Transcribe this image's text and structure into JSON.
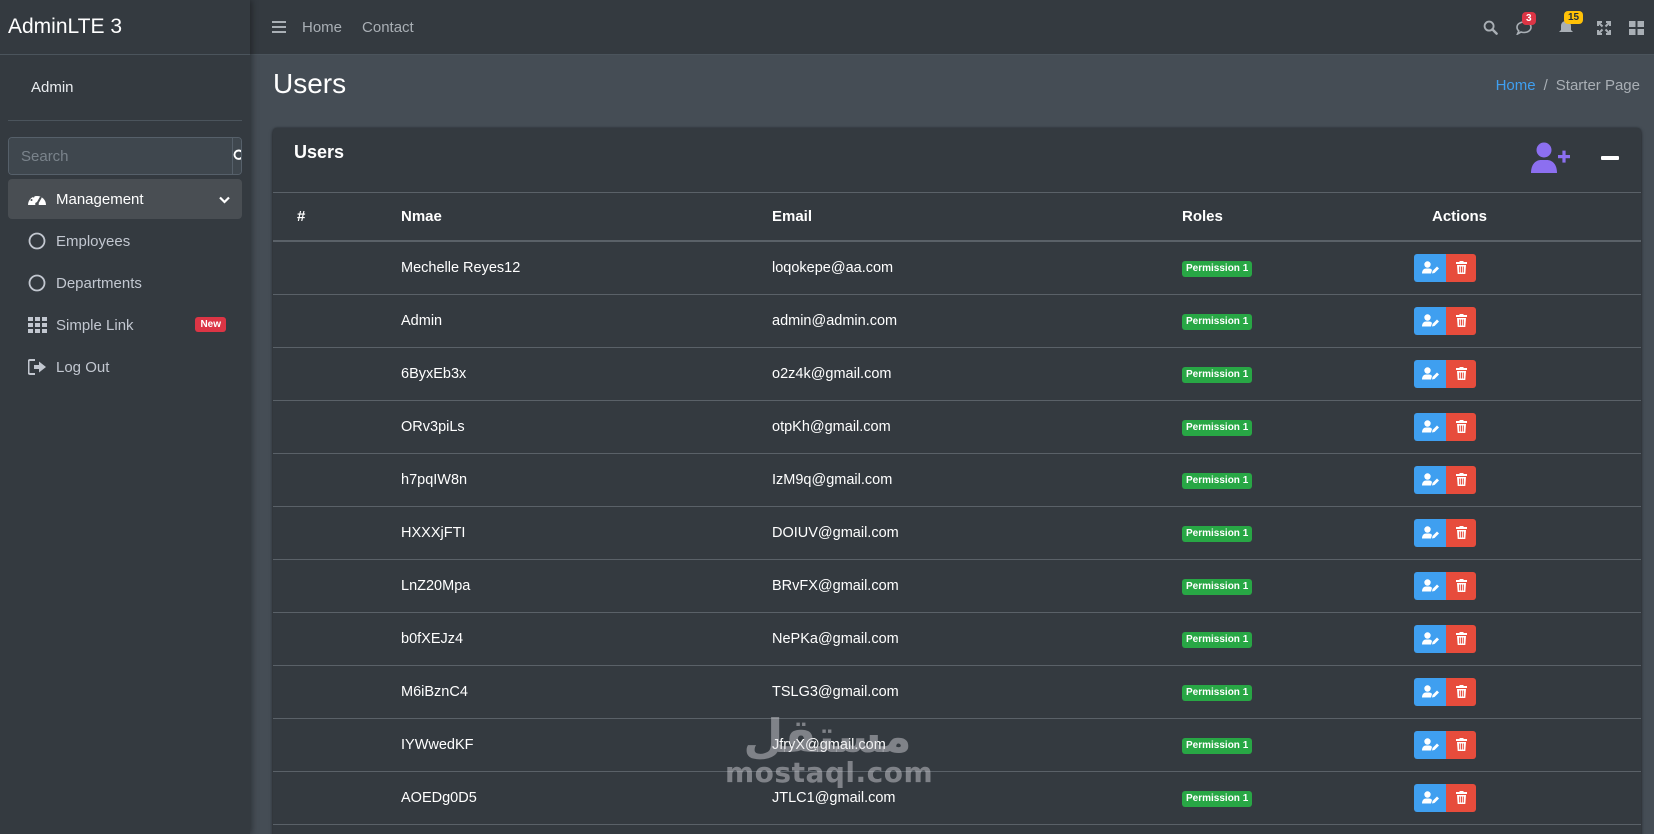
{
  "brand": "AdminLTE 3",
  "user": {
    "name": "Admin"
  },
  "sidebar": {
    "search_placeholder": "Search",
    "items": [
      {
        "label": "Management"
      },
      {
        "label": "Employees"
      },
      {
        "label": "Departments"
      },
      {
        "label": "Simple Link",
        "badge": "New"
      },
      {
        "label": "Log Out"
      }
    ]
  },
  "topbar": {
    "links": [
      "Home",
      "Contact"
    ],
    "notifications": {
      "messages": "3",
      "alerts": "15"
    }
  },
  "page": {
    "title": "Users",
    "breadcrumb": {
      "home": "Home",
      "current": "Starter Page"
    }
  },
  "card": {
    "title": "Users",
    "columns": [
      "#",
      "Nmae",
      "Email",
      "Roles",
      "Actions"
    ],
    "rows": [
      {
        "num": "",
        "name": "Mechelle Reyes12",
        "email": "loqokepe@aa.com",
        "role": "Permission 1"
      },
      {
        "num": "",
        "name": "Admin",
        "email": "admin@admin.com",
        "role": "Permission 1"
      },
      {
        "num": "",
        "name": "6ByxEb3x",
        "email": "o2z4k@gmail.com",
        "role": "Permission 1"
      },
      {
        "num": "",
        "name": "ORv3piLs",
        "email": "otpKh@gmail.com",
        "role": "Permission 1"
      },
      {
        "num": "",
        "name": "h7pqIW8n",
        "email": "IzM9q@gmail.com",
        "role": "Permission 1"
      },
      {
        "num": "",
        "name": "HXXXjFTI",
        "email": "DOIUV@gmail.com",
        "role": "Permission 1"
      },
      {
        "num": "",
        "name": "LnZ20Mpa",
        "email": "BRvFX@gmail.com",
        "role": "Permission 1"
      },
      {
        "num": "",
        "name": "b0fXEJz4",
        "email": "NePKa@gmail.com",
        "role": "Permission 1"
      },
      {
        "num": "",
        "name": "M6iBznC4",
        "email": "TSLG3@gmail.com",
        "role": "Permission 1"
      },
      {
        "num": "",
        "name": "IYWwedKF",
        "email": "JfryX@gmail.com",
        "role": "Permission 1"
      },
      {
        "num": "",
        "name": "AOEDg0D5",
        "email": "JTLC1@gmail.com",
        "role": "Permission 1"
      }
    ]
  },
  "watermark": {
    "arabic": "مستقل",
    "latin": "mostaql.com"
  },
  "colors": {
    "sidebar_bg": "#343a40",
    "content_bg": "#454d55",
    "link_blue": "#3f9ff0",
    "success_green": "#28a745",
    "danger_red": "#e74c3c",
    "accent_purple": "#8c6ff0"
  },
  "icons": {
    "topbar": [
      "bars-icon",
      "search-icon",
      "comments-icon",
      "bell-icon",
      "expand-icon",
      "grid-icon"
    ],
    "sidebar": [
      "dashboard-icon",
      "circle-icon",
      "circle-icon",
      "th-icon",
      "sign-out-icon"
    ],
    "card": [
      "user-plus-icon",
      "minus-icon"
    ],
    "row_actions": [
      "user-edit-icon",
      "trash-icon"
    ]
  }
}
